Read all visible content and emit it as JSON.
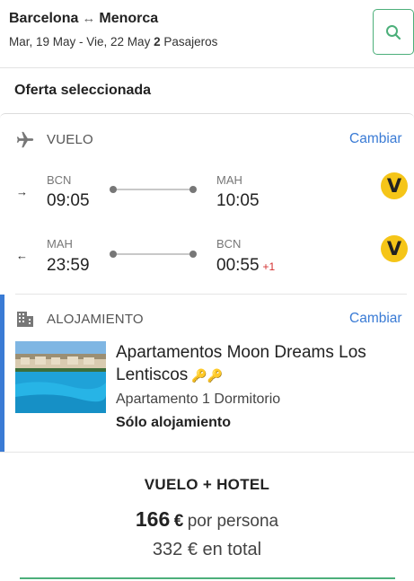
{
  "header": {
    "origin": "Barcelona",
    "route_arrow": "↔",
    "destination": "Menorca",
    "dates": "Mar, 19 May - Vie, 22 May",
    "passengers_count": "2",
    "passengers_label": "Pasajeros",
    "search_icon": "search-icon"
  },
  "section_title": "Oferta seleccionada",
  "flight": {
    "label": "VUELO",
    "change_label": "Cambiar",
    "icon": "airplane-icon",
    "legs": [
      {
        "direction_arrow": "→",
        "from_code": "BCN",
        "from_time": "09:05",
        "to_code": "MAH",
        "to_time": "10:05",
        "day_offset": "",
        "airline_logo": "V",
        "airline_color": "#f5c518"
      },
      {
        "direction_arrow": "←",
        "from_code": "MAH",
        "from_time": "23:59",
        "to_code": "BCN",
        "to_time": "00:55",
        "day_offset": "+1",
        "airline_logo": "V",
        "airline_color": "#f5c518"
      }
    ]
  },
  "accommodation": {
    "label": "ALOJAMIENTO",
    "change_label": "Cambiar",
    "icon": "building-icon",
    "hotel_name": "Apartamentos Moon Dreams Los Lentiscos",
    "keys_icon": "🔑🔑",
    "room_type": "Apartamento 1 Dormitorio",
    "board": "Sólo alojamiento"
  },
  "package": {
    "title": "VUELO + HOTEL",
    "price_per_person": "166",
    "currency": "€",
    "per_person_label": "por persona",
    "total_price": "332",
    "total_label": "en total"
  },
  "colors": {
    "accent_blue": "#3a7bd5",
    "brand_green": "#4caf7a",
    "airline_yellow": "#f5c518",
    "day_offset_red": "#d32f2f"
  }
}
